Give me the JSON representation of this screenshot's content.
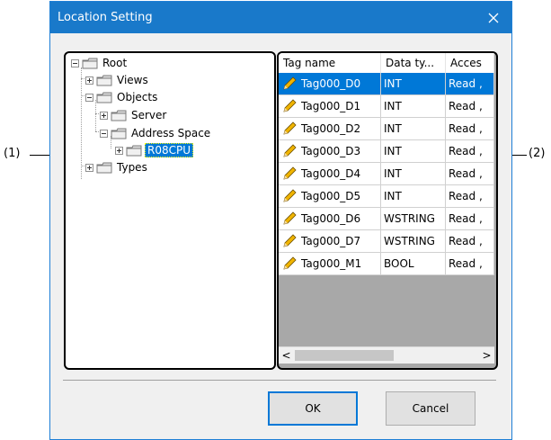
{
  "callouts": {
    "left": "(1)",
    "right": "(2)"
  },
  "dialog": {
    "title": "Location Setting",
    "close_glyph": "✕"
  },
  "tree": {
    "root": "Root",
    "views": "Views",
    "objects": "Objects",
    "server": "Server",
    "address_space": "Address Space",
    "device": "R08CPU",
    "types": "Types"
  },
  "table": {
    "columns": [
      "Tag name",
      "Data ty...",
      "Acces"
    ],
    "rows": [
      {
        "name": "Tag000_D0",
        "type": "INT",
        "access": "Read ,",
        "selected": true
      },
      {
        "name": "Tag000_D1",
        "type": "INT",
        "access": "Read ,"
      },
      {
        "name": "Tag000_D2",
        "type": "INT",
        "access": "Read ,"
      },
      {
        "name": "Tag000_D3",
        "type": "INT",
        "access": "Read ,"
      },
      {
        "name": "Tag000_D4",
        "type": "INT",
        "access": "Read ,"
      },
      {
        "name": "Tag000_D5",
        "type": "INT",
        "access": "Read ,"
      },
      {
        "name": "Tag000_D6",
        "type": "WSTRING",
        "access": "Read ,"
      },
      {
        "name": "Tag000_D7",
        "type": "WSTRING",
        "access": "Read ,"
      },
      {
        "name": "Tag000_M1",
        "type": "BOOL",
        "access": "Read ,"
      }
    ],
    "scroll_left": "<",
    "scroll_right": ">"
  },
  "buttons": {
    "ok": "OK",
    "cancel": "Cancel"
  },
  "colors": {
    "titlebar": "#1979ca",
    "selection": "#0078d7",
    "folder": "#e8c25a",
    "pencil": "#f0b400"
  },
  "icons": {
    "tree_node": "folder-icon",
    "row": "tag-pencil-icon",
    "close": "close-icon"
  }
}
